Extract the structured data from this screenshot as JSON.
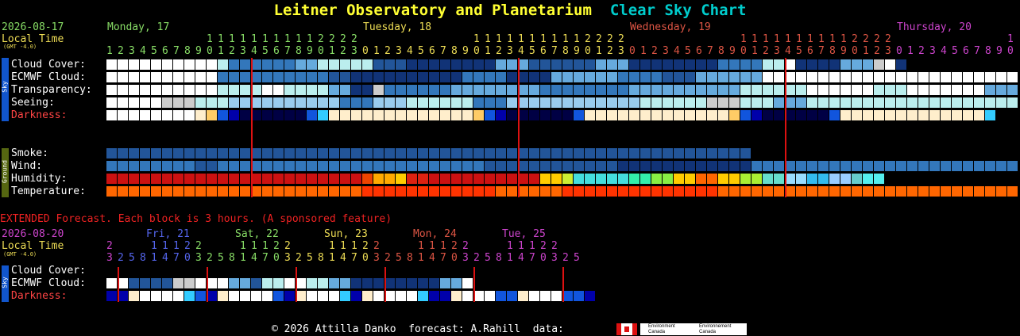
{
  "header": {
    "title_main": "Leitner Observatory and Planetarium",
    "title_sub": "Clear Sky Chart"
  },
  "top": {
    "date": "2026-08-17",
    "local_time": "Local Time",
    "gmt": "(GMT -4.0)",
    "days": [
      {
        "label": "Monday, 17",
        "color": "#88dd66"
      },
      {
        "label": "Tuesday, 18",
        "color": "#eedd55"
      },
      {
        "label": "Wednesday, 19",
        "color": "#dd5544"
      },
      {
        "label": "Thursday, 20",
        "color": "#cc44cc"
      }
    ],
    "hour_tens": "1 1 1 1 1 1 1 1 1 1 1 2 2 2 2",
    "sky_tab": "Sky",
    "ground_tab": "Ground",
    "rows": [
      "Cloud Cover:",
      "ECMWF Cloud:",
      "Transparency:",
      "Seeing:",
      "Darkness:"
    ],
    "ground_rows": [
      "Smoke:",
      "Wind:",
      "Humidity:",
      "Temperature:"
    ]
  },
  "extended": {
    "notice": "EXTENDED Forecast. Each block is 3 hours. (A sponsored feature)",
    "date": "2026-08-20",
    "local_time": "Local Time",
    "gmt": "(GMT -4.0)",
    "days": [
      {
        "label": "Fri, 21",
        "color": "#5566ee"
      },
      {
        "label": "Sat, 22",
        "color": "#88dd66"
      },
      {
        "label": "Sun, 23",
        "color": "#eedd55"
      },
      {
        "label": "Mon, 24",
        "color": "#dd5544"
      },
      {
        "label": "Tue, 25",
        "color": "#cc44cc"
      }
    ],
    "rows": [
      "Cloud Cover:",
      "ECMWF Cloud:",
      "Darkness:"
    ]
  },
  "footer": {
    "copyright": "© 2026 Attilla Danko  forecast: A.Rahill  data:",
    "env1": "Environment Canada",
    "env2": "Environnement Canada"
  }
}
